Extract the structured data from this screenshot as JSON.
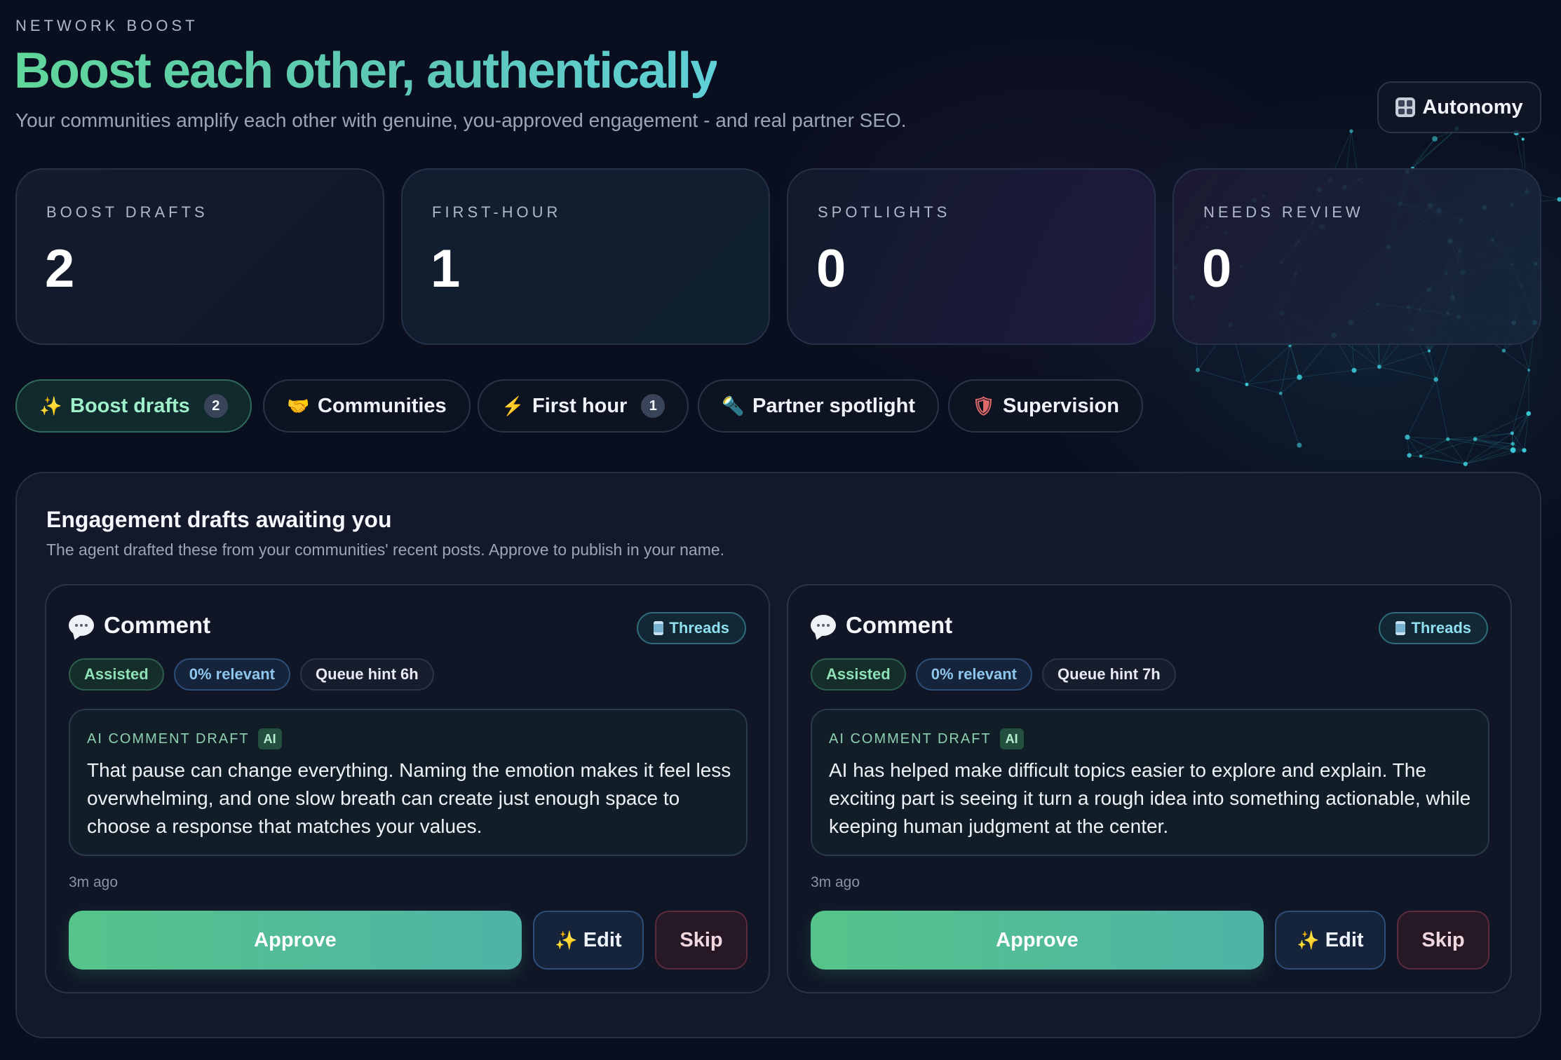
{
  "header": {
    "eyebrow": "NETWORK BOOST",
    "title": "Boost each other, authentically",
    "subtitle": "Your communities amplify each other with genuine, you-approved engagement - and real partner SEO.",
    "autonomy_label": "Autonomy"
  },
  "stats": [
    {
      "label": "BOOST DRAFTS",
      "value": "2"
    },
    {
      "label": "FIRST-HOUR",
      "value": "1"
    },
    {
      "label": "SPOTLIGHTS",
      "value": "0"
    },
    {
      "label": "NEEDS REVIEW",
      "value": "0"
    }
  ],
  "tabs": [
    {
      "icon": "sparkles-icon",
      "label": "Boost drafts",
      "badge": "2",
      "active": true
    },
    {
      "icon": "handshake-icon",
      "label": "Communities",
      "badge": ""
    },
    {
      "icon": "lightning-icon",
      "label": "First hour",
      "badge": "1"
    },
    {
      "icon": "flashlight-icon",
      "label": "Partner spotlight",
      "badge": ""
    },
    {
      "icon": "shield-icon",
      "label": "Supervision",
      "badge": ""
    }
  ],
  "panel": {
    "title": "Engagement drafts awaiting you",
    "subtitle": "The agent drafted these from your communities' recent posts. Approve to publish in your name."
  },
  "cards": [
    {
      "type": "Comment",
      "platform": "Threads",
      "pills": [
        "Assisted",
        "0% relevant",
        "Queue hint 6h"
      ],
      "draft_label": "AI COMMENT DRAFT",
      "ai_badge": "AI",
      "draft_text": "That pause can change everything. Naming the emotion makes it feel less overwhelming, and one slow breath can create just enough space to choose a response that matches your values.",
      "time": "3m ago",
      "approve": "Approve",
      "edit": "Edit",
      "skip": "Skip"
    },
    {
      "type": "Comment",
      "platform": "Threads",
      "pills": [
        "Assisted",
        "0% relevant",
        "Queue hint 7h"
      ],
      "draft_label": "AI COMMENT DRAFT",
      "ai_badge": "AI",
      "draft_text": "AI has helped make difficult topics easier to explore and explain. The exciting part is seeing it turn a rough idea into something actionable, while keeping human judgment at the center.",
      "time": "3m ago",
      "approve": "Approve",
      "edit": "Edit",
      "skip": "Skip"
    }
  ],
  "colors": {
    "background": "#0a0f1f",
    "accent_green": "#55c48a",
    "accent_teal": "#4fb3a6",
    "network_node": "#3fd2e0"
  }
}
